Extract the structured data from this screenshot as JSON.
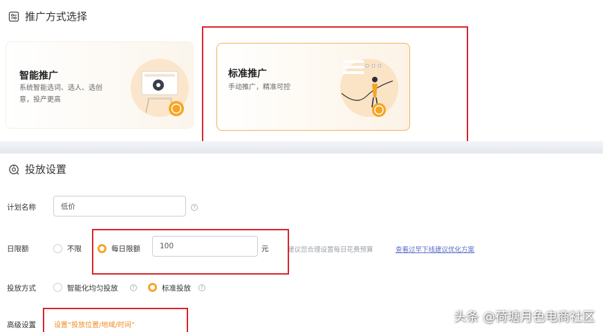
{
  "promo_section": {
    "title": "推广方式选择",
    "cards": [
      {
        "title": "智能推广",
        "desc_line1": "系统智能选词、选人、选创",
        "desc_line2": "意，投产更高"
      },
      {
        "title": "标准推广",
        "desc_line1": "手动推广，精准可控"
      }
    ]
  },
  "delivery_section": {
    "title": "投放设置",
    "plan_name": {
      "label": "计划名称",
      "value": "低价"
    },
    "daily_limit": {
      "label": "日限额",
      "options": [
        "不限",
        "每日限额"
      ],
      "selected": "每日限额",
      "value": "100",
      "unit": "元",
      "hint": "建议您合理设置每日花费预算",
      "link": "查看过早下线建议优化方案"
    },
    "delivery_method": {
      "label": "投放方式",
      "options": [
        "智能化均匀投放",
        "标准投放"
      ],
      "selected": "标准投放"
    },
    "advanced": {
      "label": "高级设置",
      "link": "设置“投放位置/地域/时间”"
    }
  },
  "watermark": "头条 @荷塘月色电商社区",
  "colors": {
    "accent": "#f5a524",
    "highlight_box": "#d9222a",
    "link_orange": "#f08b1d",
    "link_blue": "#5b6fc7"
  }
}
